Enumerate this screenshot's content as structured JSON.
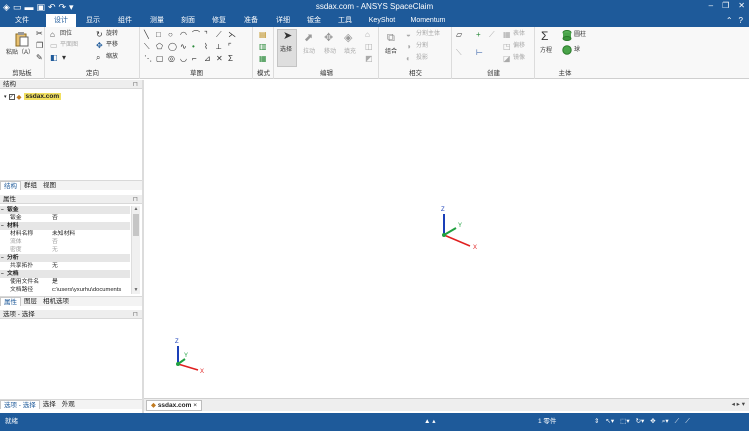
{
  "window": {
    "title": "ssdax.com - ANSYS SpaceClaim"
  },
  "menu": {
    "tabs": [
      "文件",
      "设计",
      "显示",
      "组件",
      "测量",
      "刻面",
      "修复",
      "准备",
      "详细",
      "钣金",
      "工具",
      "KeyShot",
      "Momentum"
    ],
    "active": "设计"
  },
  "ribbon": {
    "clipboard": {
      "paste": "粘贴（A）",
      "label": "剪贴板"
    },
    "orient": {
      "home": "回位",
      "rotate": "旋转",
      "plane_view": "平面图",
      "pan": "平移",
      "zoom": "缩放",
      "label": "定向"
    },
    "sketch": {
      "label": "草图"
    },
    "mode": {
      "label": "模式"
    },
    "edit": {
      "select": "选择",
      "pull": "拉动",
      "move": "移动",
      "fill": "填充",
      "label": "编辑"
    },
    "intersect": {
      "combine": "组合",
      "split_body": "分割主体",
      "split": "分割",
      "project": "投影",
      "label": "相交"
    },
    "create": {
      "table": "表体",
      "offset": "偏移",
      "mirror": "镜像",
      "label": "创建"
    },
    "body": {
      "equation": "方程",
      "cylinder": "圆柱",
      "sphere": "球",
      "label": "主体"
    }
  },
  "structure_panel": {
    "title": "结构",
    "root": "ssdax.com",
    "tabs": [
      "结构",
      "群组",
      "视图"
    ],
    "active_tab": "结构"
  },
  "properties_panel": {
    "title": "属性",
    "rows": [
      {
        "type": "cat",
        "k": "钣金"
      },
      {
        "type": "row",
        "k": "钣金",
        "v": "否"
      },
      {
        "type": "cat",
        "k": "材料"
      },
      {
        "type": "row",
        "k": "材料名称",
        "v": "未知材料"
      },
      {
        "type": "dim",
        "k": "流体",
        "v": "否"
      },
      {
        "type": "dim",
        "k": "密度",
        "v": "无"
      },
      {
        "type": "cat",
        "k": "分析"
      },
      {
        "type": "row",
        "k": "共享拓扑",
        "v": "无"
      },
      {
        "type": "cat",
        "k": "文档"
      },
      {
        "type": "row",
        "k": "使用文件名",
        "v": "是"
      },
      {
        "type": "row",
        "k": "文档路径",
        "v": "c:\\users\\yxurhu\\documents"
      }
    ],
    "tabs": [
      "属性",
      "图层",
      "相机选项"
    ],
    "active_tab": "属性"
  },
  "options_panel": {
    "title": "选项 - 选择",
    "tabs": [
      "选项 - 选择",
      "选择",
      "外观"
    ],
    "active_tab": "选项 - 选择"
  },
  "document_tabs": {
    "tab": "ssdax.com",
    "close": "×"
  },
  "axes": {
    "x": "X",
    "y": "Y",
    "z": "Z"
  },
  "status": {
    "message": "就绪",
    "parts": "1 零件"
  },
  "colors": {
    "brand": "#1e5a9a",
    "x_axis": "#e02020",
    "y_axis": "#20a040",
    "z_axis": "#1a3fb8"
  }
}
